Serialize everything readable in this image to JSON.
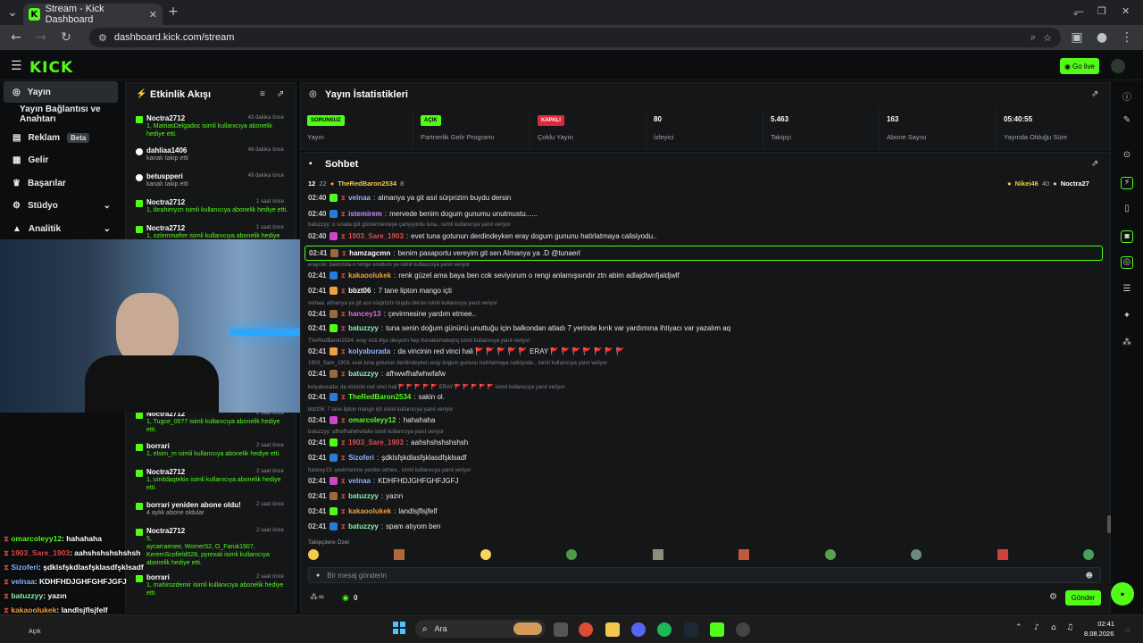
{
  "browser": {
    "tab_title": "Stream - Kick Dashboard",
    "url": "dashboard.kick.com/stream",
    "new_tab": "+"
  },
  "header": {
    "logo": "KICK",
    "go_live": "Go live"
  },
  "sidebar": {
    "items": [
      {
        "label": "Yayın"
      },
      {
        "label": "Yayın Bağlantısı ve Anahtarı"
      },
      {
        "label": "Reklam",
        "badge": "Beta"
      },
      {
        "label": "Gelir"
      },
      {
        "label": "Başarılar"
      },
      {
        "label": "Stüdyo"
      },
      {
        "label": "Analitik"
      }
    ]
  },
  "activity": {
    "title": "Etkinlik Akışı",
    "events": [
      {
        "name": "Noctra2712",
        "time": "43 dakika önce",
        "line1": "1, MatriasDelgadoc isimli kullanıcıya abonelik",
        "line2": "hediye etti."
      },
      {
        "name": "dahliaa1406",
        "time": "48 dakika önce",
        "line1": "kanalı takip etti",
        "line2": ""
      },
      {
        "name": "betuspperi",
        "time": "49 dakika önce",
        "line1": "kanalı takip etti",
        "line2": ""
      },
      {
        "name": "Noctra2712",
        "time": "1 saat önce",
        "line1": "1, ibrahimyzn isimli kullanıcıya abonelik hediye etti.",
        "line2": ""
      },
      {
        "name": "Noctra2712",
        "time": "1 saat önce",
        "line1": "1, ozlemmafter isimli kullanıcıya abonelik hediye",
        "line2": ""
      },
      {
        "name": "Noctra2712",
        "time": "2 saat önce",
        "line1": "1, Tugce_0077 isimli kullanıcıya abonelik hediye",
        "line2": "etti."
      },
      {
        "name": "borrari",
        "time": "2 saat önce",
        "line1": "1, elsim_m isimli kullanıcıya abonelik hediye etti.",
        "line2": ""
      },
      {
        "name": "Noctra2712",
        "time": "2 saat önce",
        "line1": "1, umitdaqtekin isimli kullanıcıya abonelik hediye",
        "line2": "etti."
      },
      {
        "name": "borrari yeniden abone oldu!",
        "time": "2 saat önce",
        "line1": "4 aylık abone oldular",
        "line2": ""
      },
      {
        "name": "Noctra2712",
        "time": "2 saat önce",
        "line1": "5,",
        "line2": "aycarraenee, Womer52, O_Faruk1907, KeremScofield028, pyrexali isimli kullanıcıya abonelik hediye etti."
      },
      {
        "name": "borrari",
        "time": "2 saat önce",
        "line1": "1, mahirozdemir isimli kullanıcıya abonelik hediye",
        "line2": "etti."
      }
    ]
  },
  "stats": {
    "title": "Yayın İstatistikleri",
    "cards": [
      {
        "pill": "SORUNSUZ",
        "label": "Yayın",
        "color": "#53fc18"
      },
      {
        "pill": "AÇIK",
        "label": "Partnerlik Gelir Programı",
        "color": "#53fc18"
      },
      {
        "pill": "KAPALI",
        "label": "Çoklu Yayın",
        "color": "#e0283c"
      },
      {
        "value": "80",
        "label": "İzleyici"
      },
      {
        "value": "5.463",
        "label": "Takipçi"
      },
      {
        "value": "163",
        "label": "Abone Sayısı"
      },
      {
        "value": "05:40:55",
        "label": "Yayında Olduğu Süre"
      }
    ]
  },
  "chat": {
    "title": "Sohbet",
    "top_left": "12",
    "top_left_count": "22",
    "top_user": "TheRedBaron2534",
    "top_user_count": "8",
    "top_right1": "Nikei46",
    "top_right1_count": "40",
    "top_right2": "Noctra27",
    "messages": [
      {
        "type": "m",
        "time": "02:40",
        "user": "velnaa",
        "color": "#8fb4ff",
        "text": "almanya ya git asıl sürprizim buydu dersin"
      },
      {
        "type": "m",
        "time": "02:40",
        "user": "istemirem",
        "color": "#c98bff",
        "text": "mervede benim dogum gunumu unutmustu......"
      },
      {
        "type": "r",
        "text": "batuzzyy: o sırada göt göstermemeye çalışıyordu tuna.. isimli kullanıcıya yanıt veriyor"
      },
      {
        "type": "m",
        "time": "02:40",
        "user": "1903_Sare_1903",
        "color": "#e24a4a",
        "text": "evet tuna gotunun derdindeyken eray dogum gununu hatirlatmaya calisiyodu.."
      },
      {
        "type": "m",
        "time": "02:41",
        "user": "hamzagcmn",
        "color": "#ffffff",
        "text": "benim pasaportu vereyim git sen Almanya ya .D @tunaerl",
        "highlight": true
      },
      {
        "type": "r",
        "text": "eraycivi: baktımda o renge unuttum ya isimli kullanıcıya yanıt veriyor"
      },
      {
        "type": "m",
        "time": "02:41",
        "user": "kakaoolukek",
        "color": "#f2a03d",
        "text": "renk güzel ama baya ben cok seviyorum o rengi anlamışsındır ztn abim adlajdlwnfjaldjwlf"
      },
      {
        "type": "m",
        "time": "02:41",
        "user": "bbzt06",
        "color": "#ffffff",
        "text": "7 tane lipton mango içti"
      },
      {
        "type": "r",
        "text": "velnaa: almanya ya git asıl sürprizim buydu dersin isimli kullanıcıya yanıt veriyor"
      },
      {
        "type": "m",
        "time": "02:41",
        "user": "hancey13",
        "color": "#e070d0",
        "text": "çevirmesine yardım etmee.."
      },
      {
        "type": "m",
        "time": "02:41",
        "user": "batuzzyy",
        "color": "#8ef0b0",
        "text": "tuna senin doğum gününü unuttuğu için balkondan atladı 7 yerinde kırık var yardımına ihtiyacı var yazalım aq"
      },
      {
        "type": "r",
        "text": "TheRedBaron2534: eray vicii diye okuyorn hep Kenakemwkqnq isimli kullanıcıya yanıt veriyor"
      },
      {
        "type": "m",
        "time": "02:41",
        "user": "kolyaburada",
        "color": "#8fb4ff",
        "text": "da vincinin red vinci hali 🚩 🚩 🚩 🚩 🚩 ERAY 🚩 🚩 🚩 🚩 🚩 🚩 🚩"
      },
      {
        "type": "r",
        "text": "1903_Sare_1903: evet tuna gotunun derdindeyken eray dogum gununu hatirlatmaya calisiyodu.. isimli kullanıcıya yanıt veriyor"
      },
      {
        "type": "m",
        "time": "02:41",
        "user": "batuzzyy",
        "color": "#8ef0b0",
        "text": "afhwwfhafwhwfafw"
      },
      {
        "type": "r",
        "text": "kolyaburada: da vincinin red vinci hali 🚩 🚩 🚩 🚩 🚩 ERAY 🚩 🚩 🚩 🚩 🚩 isimli kullanıcıya yanıt veriyor"
      },
      {
        "type": "m",
        "time": "02:41",
        "user": "TheRedBaron2534",
        "color": "#53fc18",
        "text": "sakin ol."
      },
      {
        "type": "r",
        "text": "bbzt06: 7 tane lipton mango içti isimli kullanıcıya yanıt veriyor"
      },
      {
        "type": "m",
        "time": "02:41",
        "user": "omarcoleyy12",
        "color": "#53fc18",
        "text": "hahahaha"
      },
      {
        "type": "r",
        "text": "batuzzyy: afhwfhafwhwfafw isimli kullanıcıya yanıt veriyor"
      },
      {
        "type": "m",
        "time": "02:41",
        "user": "1903_Sare_1903",
        "color": "#e24a4a",
        "text": "aahshshshshshsh"
      },
      {
        "type": "m",
        "time": "02:41",
        "user": "Sizoferi",
        "color": "#8fb4ff",
        "text": "şdklsfşkdlasfşklasdfşklsadf"
      },
      {
        "type": "r",
        "text": "hancey13: çevirmesine yarden etmee.. isimli kullanıcıya yanıt veriyor"
      },
      {
        "type": "m",
        "time": "02:41",
        "user": "velnaa",
        "color": "#8fb4ff",
        "text": "KDHFHDJGHFGHFJGFJ"
      },
      {
        "type": "m",
        "time": "02:41",
        "user": "batuzzyy",
        "color": "#8ef0b0",
        "text": "yazın"
      },
      {
        "type": "m",
        "time": "02:41",
        "user": "kakaoolukek",
        "color": "#f2a03d",
        "text": "landlsjflsjfelf"
      },
      {
        "type": "m",
        "time": "02:41",
        "user": "batuzzyy",
        "color": "#8ef0b0",
        "text": "spam atıyom ben"
      }
    ],
    "followers_only": "Takipçilere Özel",
    "input_placeholder": "Bir mesaj gönderin",
    "counter": "0",
    "send": "Gönder"
  },
  "overlay_chat": [
    {
      "user": "omarcoleyy12",
      "color": "#53fc18",
      "text": ": hahahaha"
    },
    {
      "user": "1903_Sare_1903",
      "color": "#e24a4a",
      "text": ": aahshshshshshsh"
    },
    {
      "user": "Sizoferi",
      "color": "#8fb4ff",
      "text": ": şdklsfşkdlasfşklasdfşklsadf"
    },
    {
      "user": "velnaa",
      "color": "#8fb4ff",
      "text": ": KDHFHDJGHFGHFJGFJ"
    },
    {
      "user": "batuzzyy",
      "color": "#8ef0b0",
      "text": ": yazın"
    },
    {
      "user": "kakaoolukek",
      "color": "#f2a03d",
      "text": ": landlsjflsjfelf"
    },
    {
      "user": "batuzzyy",
      "color": "#8ef0b0",
      "text": ": spam atıyom ben"
    }
  ],
  "taskbar": {
    "weather": "Açık",
    "search": "Ara",
    "time": "02:41",
    "date": "8.08.2026"
  }
}
